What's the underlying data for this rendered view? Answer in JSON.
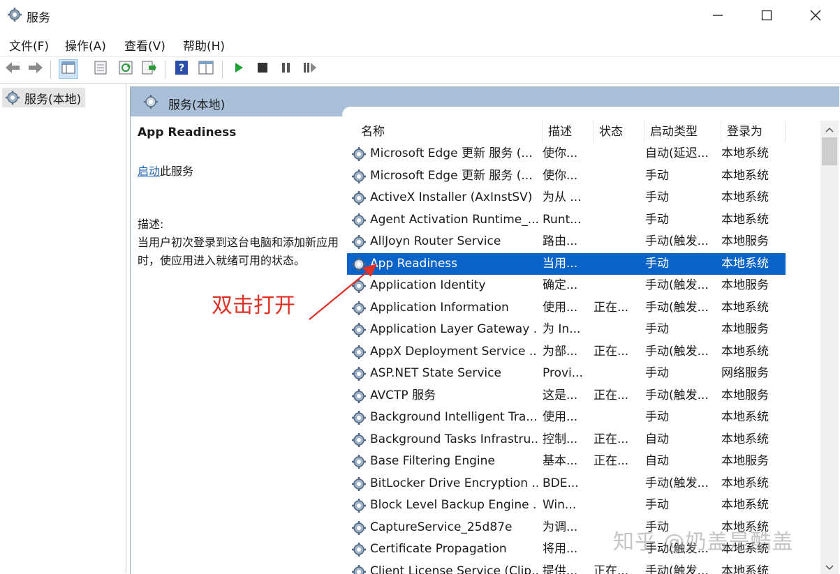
{
  "window": {
    "title": "服务",
    "icon": "gear-icon",
    "controls": [
      "minimize-icon",
      "maximize-icon",
      "close-icon"
    ]
  },
  "menu": {
    "items": [
      {
        "label": "文件(F)"
      },
      {
        "label": "操作(A)"
      },
      {
        "label": "查看(V)"
      },
      {
        "label": "帮助(H)"
      }
    ]
  },
  "toolbar": {
    "icons": [
      "back-arrow-icon",
      "forward-arrow-icon",
      "console-tree-icon",
      "properties-icon",
      "refresh-icon",
      "export-list-icon",
      "help-icon",
      "view-icon",
      "start-service-icon",
      "stop-service-icon",
      "pause-service-icon",
      "restart-service-icon"
    ]
  },
  "tree": {
    "items": [
      {
        "label": "服务(本地)"
      }
    ]
  },
  "panel": {
    "header": "服务(本地)",
    "selected_service_title": "App Readiness",
    "start_link": "启动",
    "start_suffix": "此服务",
    "desc_label": "描述:",
    "desc_text": "当用户初次登录到这台电脑和添加新应用时，使应用进入就绪可用的状态。",
    "annotation": "双击打开",
    "columns": {
      "name": "名称",
      "desc": "描述",
      "status": "状态",
      "startup": "启动类型",
      "logon": "登录为"
    },
    "rows": [
      {
        "name": "Microsoft Edge 更新 服务 (...",
        "desc": "使你...",
        "status": "",
        "startup": "自动(延迟...",
        "logon": "本地系统"
      },
      {
        "name": "Microsoft Edge 更新 服务 (...",
        "desc": "使你...",
        "status": "",
        "startup": "手动",
        "logon": "本地系统"
      },
      {
        "name": "ActiveX Installer (AxInstSV)",
        "desc": "为从 ...",
        "status": "",
        "startup": "手动",
        "logon": "本地系统"
      },
      {
        "name": "Agent Activation Runtime_...",
        "desc": "Runt...",
        "status": "",
        "startup": "手动",
        "logon": "本地系统"
      },
      {
        "name": "AllJoyn Router Service",
        "desc": "路由...",
        "status": "",
        "startup": "手动(触发...",
        "logon": "本地服务"
      },
      {
        "name": "App Readiness",
        "desc": "当用...",
        "status": "",
        "startup": "手动",
        "logon": "本地系统",
        "selected": true
      },
      {
        "name": "Application Identity",
        "desc": "确定...",
        "status": "",
        "startup": "手动(触发...",
        "logon": "本地服务"
      },
      {
        "name": "Application Information",
        "desc": "使用...",
        "status": "正在...",
        "startup": "手动(触发...",
        "logon": "本地系统"
      },
      {
        "name": "Application Layer Gateway ...",
        "desc": "为 In...",
        "status": "",
        "startup": "手动",
        "logon": "本地服务"
      },
      {
        "name": "AppX Deployment Service ...",
        "desc": "为部...",
        "status": "正在...",
        "startup": "手动(触发...",
        "logon": "本地系统"
      },
      {
        "name": "ASP.NET State Service",
        "desc": "Provi...",
        "status": "",
        "startup": "手动",
        "logon": "网络服务"
      },
      {
        "name": "AVCTP 服务",
        "desc": "这是...",
        "status": "正在...",
        "startup": "手动(触发...",
        "logon": "本地服务"
      },
      {
        "name": "Background Intelligent Tra...",
        "desc": "使用...",
        "status": "",
        "startup": "手动",
        "logon": "本地系统"
      },
      {
        "name": "Background Tasks Infrastru...",
        "desc": "控制...",
        "status": "正在...",
        "startup": "自动",
        "logon": "本地系统"
      },
      {
        "name": "Base Filtering Engine",
        "desc": "基本...",
        "status": "正在...",
        "startup": "自动",
        "logon": "本地服务"
      },
      {
        "name": "BitLocker Drive Encryption ...",
        "desc": "BDE...",
        "status": "",
        "startup": "手动(触发...",
        "logon": "本地系统"
      },
      {
        "name": "Block Level Backup Engine ...",
        "desc": "Win...",
        "status": "",
        "startup": "手动",
        "logon": "本地系统"
      },
      {
        "name": "CaptureService_25d87e",
        "desc": "为调...",
        "status": "",
        "startup": "手动",
        "logon": "本地系统"
      },
      {
        "name": "Certificate Propagation",
        "desc": "将用...",
        "status": "",
        "startup": "手动(触发...",
        "logon": "本地系统"
      },
      {
        "name": "Client License Service (Clip...",
        "desc": "提供...",
        "status": "正在...",
        "startup": "手动(触发...",
        "logon": "本地系统"
      }
    ]
  },
  "watermark": "知乎 @奶盖是酷盖",
  "colors": {
    "selection": "#0a64c8",
    "panel_header": "#a9c0d8",
    "annotation": "#e03025",
    "link": "#1a5fb4"
  }
}
